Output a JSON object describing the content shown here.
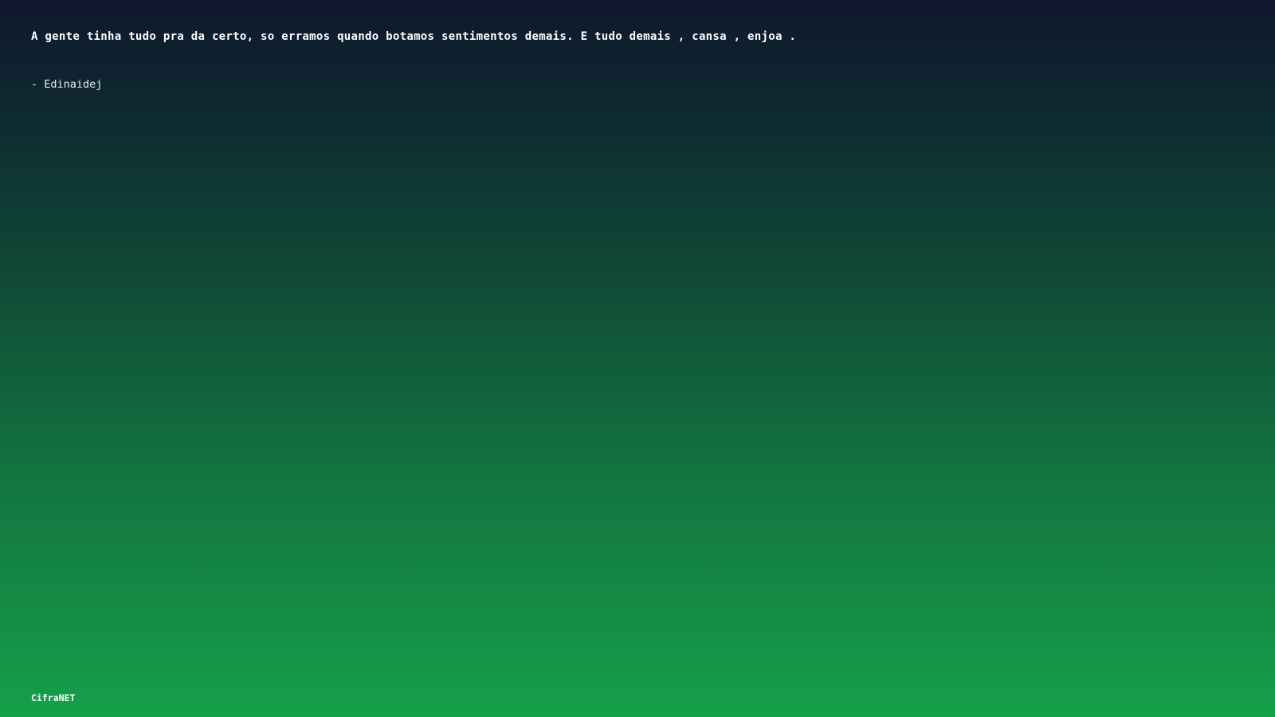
{
  "quote": {
    "text": "A gente tinha tudo pra da certo, so erramos quando botamos sentimentos demais. E tudo demais , cansa , enjoa .",
    "author": "- Edinaidej"
  },
  "footer": {
    "brand": "CifraNET"
  },
  "colors": {
    "gradient_top": "#0f172d",
    "gradient_bottom": "#15a049",
    "text": "#ffffff"
  }
}
